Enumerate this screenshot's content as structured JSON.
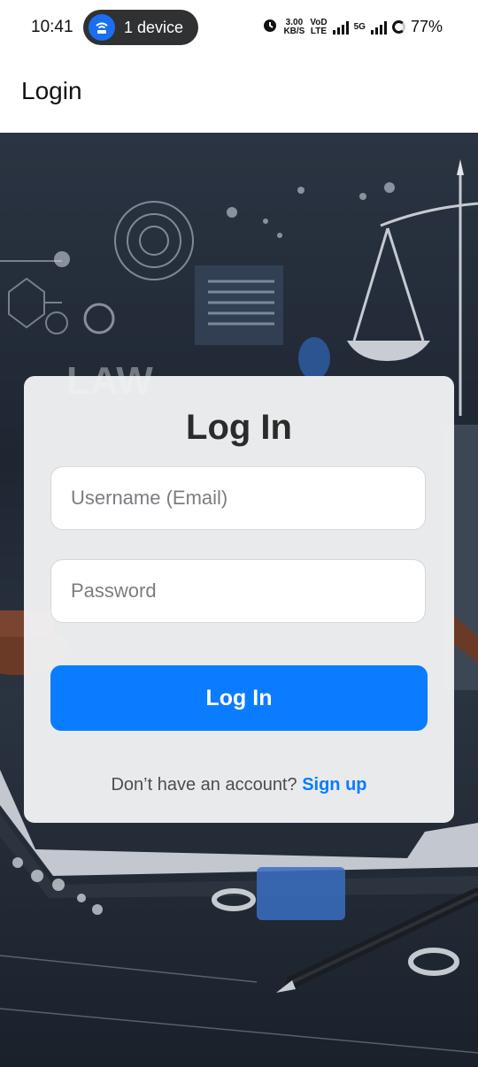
{
  "status_bar": {
    "time": "10:41",
    "device_label": "1 device",
    "net_speed_top": "3.00",
    "net_speed_bottom": "KB/S",
    "volte_top": "VoD",
    "volte_bottom": "LTE",
    "network": "5G",
    "battery": "77%"
  },
  "app_bar": {
    "title": "Login"
  },
  "illustration": {
    "law_text": "LAW"
  },
  "login_card": {
    "title": "Log In",
    "username_placeholder": "Username (Email)",
    "password_placeholder": "Password",
    "login_button": "Log In",
    "signup_prompt": "Don’t have an account?",
    "signup_link": "Sign up"
  },
  "colors": {
    "accent": "#0a7cff",
    "card_bg": "#f3f4f6"
  }
}
